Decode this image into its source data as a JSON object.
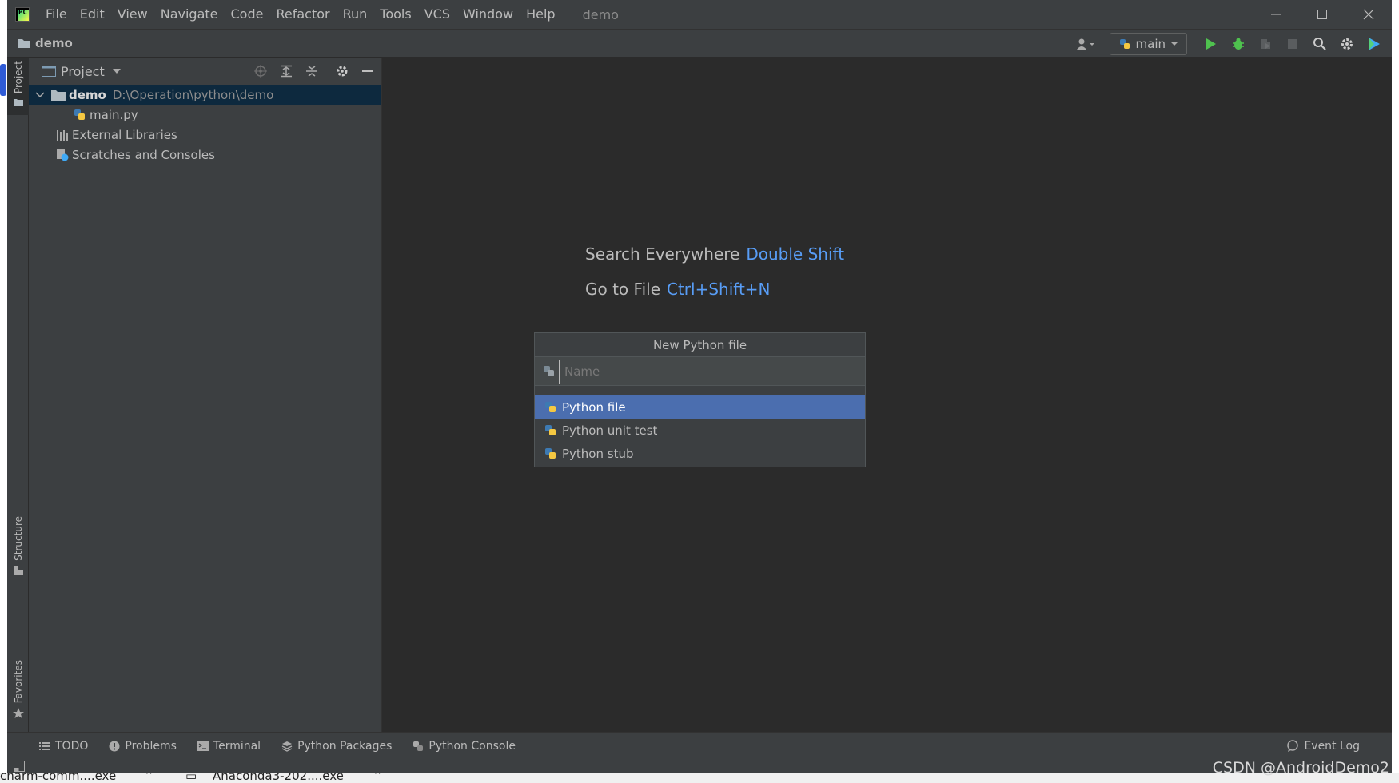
{
  "window": {
    "menu": [
      "File",
      "Edit",
      "View",
      "Navigate",
      "Code",
      "Refactor",
      "Run",
      "Tools",
      "VCS",
      "Window",
      "Help"
    ],
    "title": "demo"
  },
  "navbar": {
    "project": "demo",
    "run_config": "main"
  },
  "left_stripe": {
    "project_tab": "Project",
    "structure_tab": "Structure",
    "favorites_tab": "Favorites"
  },
  "project_panel": {
    "title": "Project",
    "tree": {
      "root_name": "demo",
      "root_path": "D:\\Operation\\python\\demo",
      "file": "main.py",
      "external_libraries": "External Libraries",
      "scratches": "Scratches and Consoles"
    }
  },
  "editor": {
    "hint_search": "Search Everywhere",
    "hint_search_key": "Double Shift",
    "hint_goto": "Go to File",
    "hint_goto_key": "Ctrl+Shift+N"
  },
  "popup": {
    "title": "New Python file",
    "input_placeholder": "Name",
    "items": [
      "Python file",
      "Python unit test",
      "Python stub"
    ]
  },
  "bottom_tabs": [
    "TODO",
    "Problems",
    "Terminal",
    "Python Packages",
    "Python Console"
  ],
  "event_log": "Event Log",
  "watermark": "CSDN @AndroidDemo2",
  "taskbar": {
    "item1": "charm-comm....exe",
    "item2": "Anaconda3-202....exe"
  },
  "colors": {
    "accent_link": "#589df6",
    "selection": "#4b6eaf",
    "tree_selection": "#0d293e",
    "run_green": "#4fc24f"
  }
}
